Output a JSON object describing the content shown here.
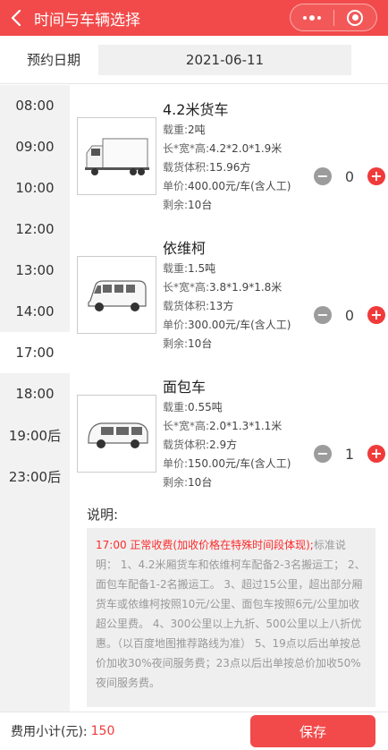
{
  "header": {
    "title": "时间与车辆选择",
    "bg_color": "#f24a4a"
  },
  "date": {
    "label": "预约日期",
    "value": "2021-06-11"
  },
  "times": [
    {
      "label": "08:00",
      "active": false
    },
    {
      "label": "09:00",
      "active": false
    },
    {
      "label": "10:00",
      "active": false
    },
    {
      "label": "12:00",
      "active": false
    },
    {
      "label": "13:00",
      "active": false
    },
    {
      "label": "14:00",
      "active": false
    },
    {
      "label": "17:00",
      "active": true
    },
    {
      "label": "18:00",
      "active": false
    },
    {
      "label": "19:00后",
      "active": false
    },
    {
      "label": "23:00后",
      "active": false
    }
  ],
  "vehicles": [
    {
      "name": "4.2米货车",
      "load_label": "载重:",
      "load": "2吨",
      "dims_label": "长*宽*高:",
      "dims": "4.2*2.0*1.9米",
      "volume_label": "载货体积:",
      "volume": "15.96方",
      "price_label": "单价:",
      "price": "400.00元/车(含人工)",
      "stock_label": "剩余:",
      "stock": "10台",
      "quantity": "0",
      "icon": "truck-icon"
    },
    {
      "name": "依维柯",
      "load_label": "载重:",
      "load": "1.5吨",
      "dims_label": "长*宽*高:",
      "dims": "3.8*1.9*1.8米",
      "volume_label": "载货体积:",
      "volume": "13方",
      "price_label": "单价:",
      "price": "300.00元/车(含人工)",
      "stock_label": "剩余:",
      "stock": "10台",
      "quantity": "0",
      "icon": "van-icon"
    },
    {
      "name": "面包车",
      "load_label": "载重:",
      "load": "0.55吨",
      "dims_label": "长*宽*高:",
      "dims": "2.0*1.3*1.1米",
      "volume_label": "载货体积:",
      "volume": "2.9方",
      "price_label": "单价:",
      "price": "150.00元/车(含人工)",
      "stock_label": "剩余:",
      "stock": "10台",
      "quantity": "1",
      "icon": "minivan-icon"
    }
  ],
  "description": {
    "title": "说明:",
    "highlight": "17:00 正常收费(加收价格在特殊时间段体现);",
    "text": "标准说明： 1、4.2米厢货车和依维柯车配备2-3名搬运工； 2、面包车配备1-2名搬运工。 3、超过15公里，超出部分厢货车或依维柯按照10元/公里、面包车按照6元/公里加收超公里费。 4、300公里以上九折、500公里以上八折优惠。（以百度地图推荐路线为准） 5、19点以后出单按总价加收30%夜间服务费；23点以后出单按总价加收50%夜间服务费。"
  },
  "footer": {
    "subtotal_label": "费用小计(元):",
    "subtotal_value": "150",
    "save_label": "保存"
  }
}
